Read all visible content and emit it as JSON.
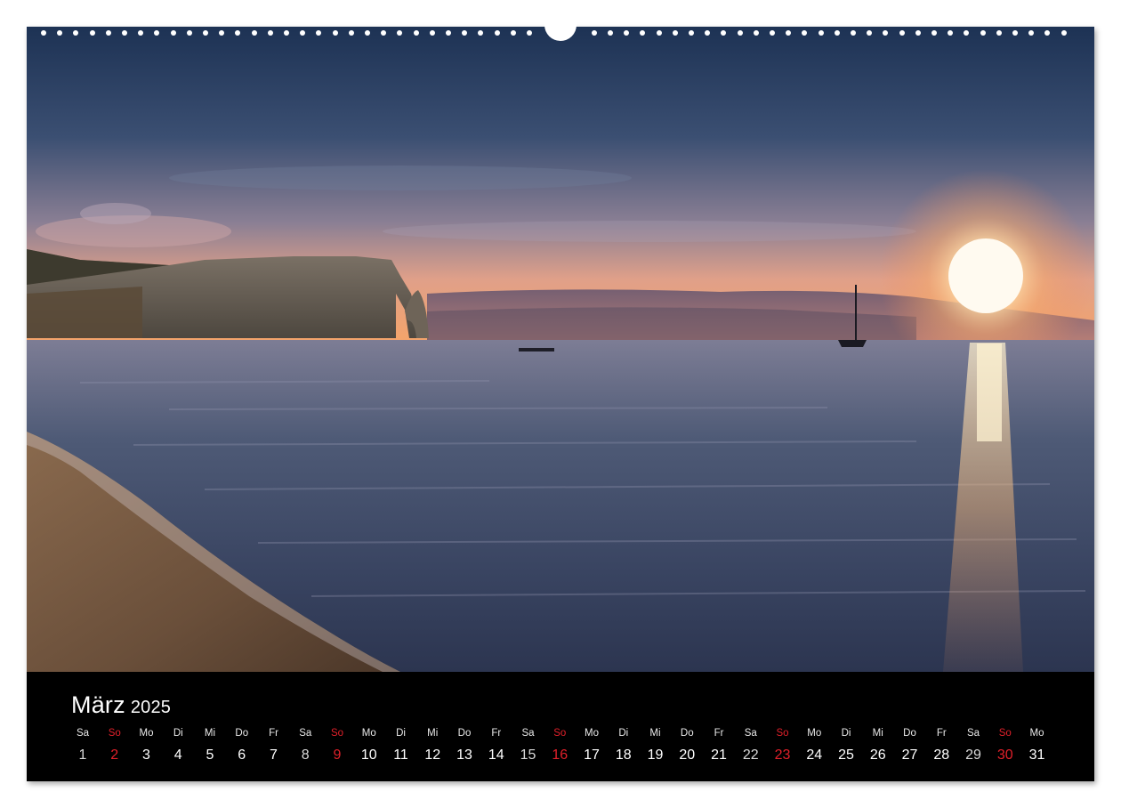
{
  "calendar": {
    "month": "März",
    "year": "2025",
    "days": [
      {
        "wd": "Sa",
        "d": "1",
        "type": "sat"
      },
      {
        "wd": "So",
        "d": "2",
        "type": "sun"
      },
      {
        "wd": "Mo",
        "d": "3",
        "type": "week"
      },
      {
        "wd": "Di",
        "d": "4",
        "type": "week"
      },
      {
        "wd": "Mi",
        "d": "5",
        "type": "week"
      },
      {
        "wd": "Do",
        "d": "6",
        "type": "week"
      },
      {
        "wd": "Fr",
        "d": "7",
        "type": "week"
      },
      {
        "wd": "Sa",
        "d": "8",
        "type": "sat"
      },
      {
        "wd": "So",
        "d": "9",
        "type": "sun"
      },
      {
        "wd": "Mo",
        "d": "10",
        "type": "week"
      },
      {
        "wd": "Di",
        "d": "11",
        "type": "week"
      },
      {
        "wd": "Mi",
        "d": "12",
        "type": "week"
      },
      {
        "wd": "Do",
        "d": "13",
        "type": "week"
      },
      {
        "wd": "Fr",
        "d": "14",
        "type": "week"
      },
      {
        "wd": "Sa",
        "d": "15",
        "type": "sat"
      },
      {
        "wd": "So",
        "d": "16",
        "type": "sun"
      },
      {
        "wd": "Mo",
        "d": "17",
        "type": "week"
      },
      {
        "wd": "Di",
        "d": "18",
        "type": "week"
      },
      {
        "wd": "Mi",
        "d": "19",
        "type": "week"
      },
      {
        "wd": "Do",
        "d": "20",
        "type": "week"
      },
      {
        "wd": "Fr",
        "d": "21",
        "type": "week"
      },
      {
        "wd": "Sa",
        "d": "22",
        "type": "sat"
      },
      {
        "wd": "So",
        "d": "23",
        "type": "sun"
      },
      {
        "wd": "Mo",
        "d": "24",
        "type": "week"
      },
      {
        "wd": "Di",
        "d": "25",
        "type": "week"
      },
      {
        "wd": "Mi",
        "d": "26",
        "type": "week"
      },
      {
        "wd": "Do",
        "d": "27",
        "type": "week"
      },
      {
        "wd": "Fr",
        "d": "28",
        "type": "week"
      },
      {
        "wd": "Sa",
        "d": "29",
        "type": "sat"
      },
      {
        "wd": "So",
        "d": "30",
        "type": "sun"
      },
      {
        "wd": "Mo",
        "d": "31",
        "type": "week"
      }
    ]
  },
  "colors": {
    "sunday": "#e0202a",
    "calendar_background": "#000000",
    "sky_top": "#1f3556",
    "sun": "#fff4d8"
  },
  "photo": {
    "icon": "sunset-coast-photo"
  }
}
